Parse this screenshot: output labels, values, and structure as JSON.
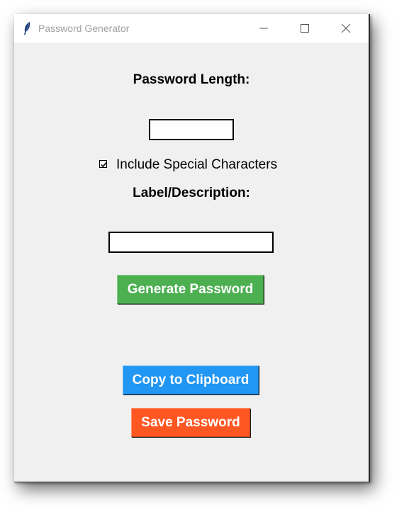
{
  "window": {
    "title": "Password Generator",
    "app_icon": "feather-icon",
    "controls": [
      "minimize-icon",
      "maximize-icon",
      "close-icon"
    ]
  },
  "form": {
    "length_label": "Password Length:",
    "length_value": "",
    "special_chars_label": "Include Special Characters",
    "special_chars_checked": true,
    "description_label": "Label/Description:",
    "description_value": ""
  },
  "buttons": {
    "generate_label": "Generate Password",
    "generate_color": "#4caf50",
    "copy_label": "Copy to Clipboard",
    "copy_color": "#2196f3",
    "save_label": "Save Password",
    "save_color": "#ff5722"
  },
  "colors": {
    "window_bg": "#f0f0f0",
    "titlebar_bg": "#ffffff",
    "title_text": "#a0a0a0"
  }
}
